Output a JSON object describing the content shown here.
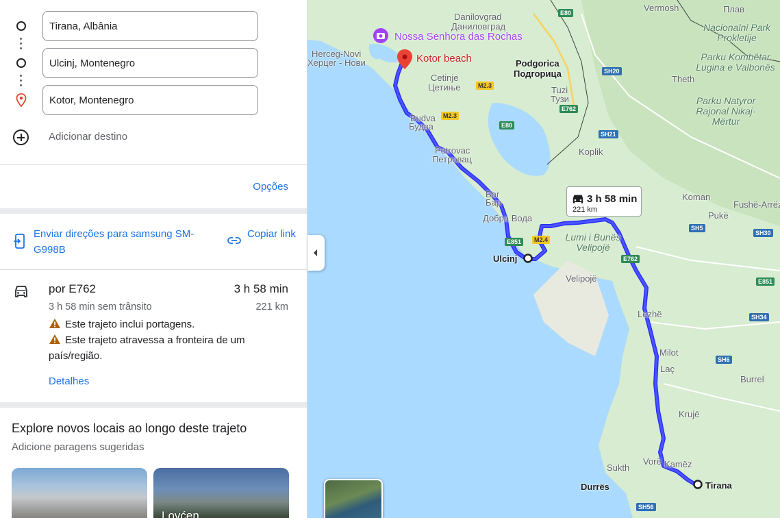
{
  "directions": {
    "waypoints": [
      {
        "value": "Tirana, Albânia",
        "icon": "origin-circle-icon"
      },
      {
        "value": "Ulcinj, Montenegro",
        "icon": "stop-circle-icon"
      },
      {
        "value": "Kotor, Montenegro",
        "icon": "destination-pin-icon"
      }
    ],
    "add_destination": "Adicionar destino",
    "options": "Opções",
    "send_directions": "Enviar direções para samsung SM-G998B",
    "copy_link": "Copiar link"
  },
  "route": {
    "name": "por E762",
    "time": "3 h 58 min",
    "no_traffic": "3 h 58 min sem trânsito",
    "distance": "221 km",
    "warnings": [
      "Este trajeto inclui portagens.",
      "Este trajeto atravessa a fronteira de um país/região."
    ],
    "details": "Detalhes"
  },
  "explore": {
    "title": "Explore novos locais ao longo deste trajeto",
    "subtitle": "Adicione paragens sugeridas",
    "cards": [
      {
        "label": ""
      },
      {
        "label": "Lovćen"
      }
    ]
  },
  "map": {
    "callout": {
      "time": "3 h 58 min",
      "distance": "221 km"
    },
    "labels": {
      "danilovgrad": "Danilovgrad",
      "danilovgrad_cyr": "Даниловград",
      "vermosh": "Vermosh",
      "plav": "Плав",
      "nossa_senhora": "Nossa Senhora das Rochas",
      "kotor_beach": "Kotor beach",
      "herceg_novi": "Herceg-Novi",
      "herceg_novi_cyr": "Херцег - Нови",
      "podgorica": "Podgorica",
      "podgorica_cyr": "Подгорица",
      "cetinje": "Cetinje",
      "cetinje_cyr": "Цетиње",
      "tuzi": "Tuzi",
      "tuzi_cyr": "Тузи",
      "theth": "Theth",
      "budva": "Budva",
      "budva_cyr": "Будва",
      "petrovac": "Petrovac",
      "petrovac_cyr": "Петровац",
      "koplik": "Koplik",
      "bar": "Bar",
      "bar_cyr": "Бар",
      "dobra_voda": "Добра Вода",
      "koman": "Koman",
      "fushe_arrez": "Fushë-Arrëz",
      "puke": "Pukë",
      "ulcinj": "Ulcinj",
      "velipoje": "Velipojë",
      "lezhe": "Lezhë",
      "milot": "Milot",
      "lac": "Laç",
      "burrel": "Burrel",
      "kruje": "Krujë",
      "vore": "Vorë",
      "kamez": "Kamëz",
      "sukth": "Sukth",
      "durres": "Durrës",
      "tirana": "Tirana",
      "park_prokletije": "Nacionalni Park Prokletije",
      "park_kombetar": "Parku Kombëtar Lugina e Valbonës",
      "park_natyror": "Parku Natyror Rajonal Nikaj-Mërtur",
      "lumi_bunes": "Lumi i Bunës Velipojë"
    },
    "shields": {
      "e80_top": "E80",
      "e80_mid": "E80",
      "m23_a": "M2.3",
      "m23_b": "M2.3",
      "e762": "E762",
      "sh20": "SH20",
      "sh21": "SH21",
      "sh5": "SH5",
      "sh30": "SH30",
      "e851_left": "E851",
      "m24": "M2.4",
      "e762_b": "E762",
      "e851_right": "E851",
      "sh34": "SH34",
      "sh6": "SH6",
      "sh56": "SH56"
    }
  }
}
